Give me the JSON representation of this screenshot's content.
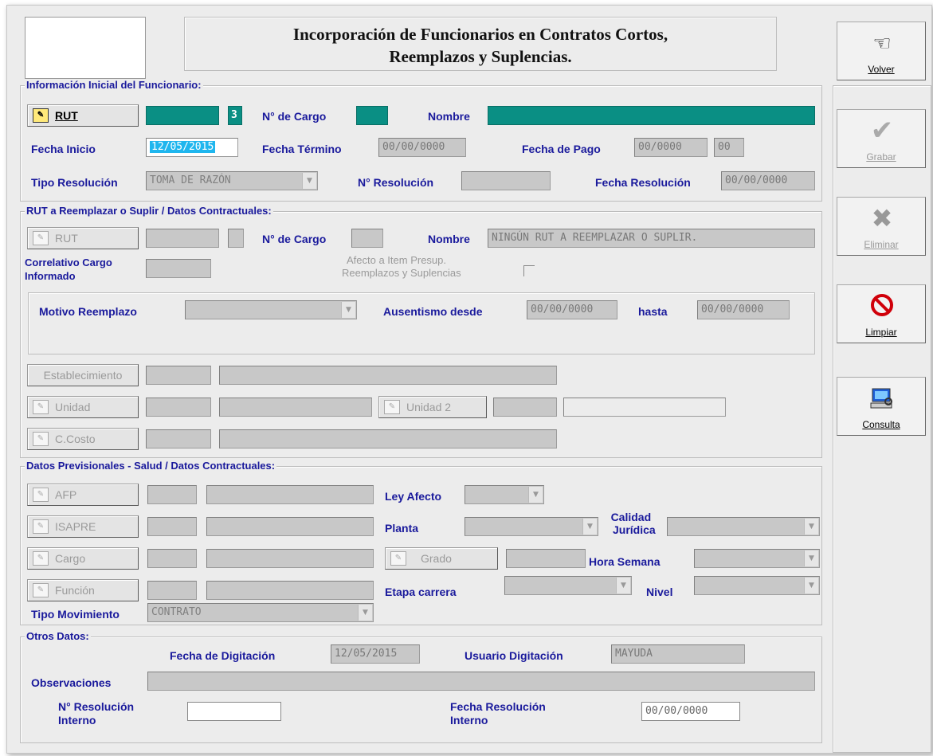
{
  "header": {
    "title_line1": "Incorporación de Funcionarios en Contratos Cortos,",
    "title_line2": "Reemplazos y Suplencias."
  },
  "sidebar": {
    "volver": "Volver",
    "grabar": "Grabar",
    "eliminar": "Eliminar",
    "limpiar": "Limpiar",
    "consulta": "Consulta"
  },
  "section1": {
    "legend": "Información Inicial del Funcionario:",
    "rut_btn": "RUT",
    "rut_value": "",
    "rut_dv": "3",
    "ncargo_label": "N° de Cargo",
    "ncargo_value": "",
    "nombre_label": "Nombre",
    "nombre_value": "",
    "fecha_inicio_label": "Fecha Inicio",
    "fecha_inicio_value": "12/05/2015",
    "fecha_termino_label": "Fecha Término",
    "fecha_termino_value": "00/00/0000",
    "fecha_pago_label": "Fecha de Pago",
    "fecha_pago_value1": "00/0000",
    "fecha_pago_value2": "00",
    "tipo_resolucion_label": "Tipo Resolución",
    "tipo_resolucion_value": "TOMA DE RAZÓN",
    "nresolucion_label": "N° Resolución",
    "nresolucion_value": "",
    "fecha_resolucion_label": "Fecha Resolución",
    "fecha_resolucion_value": "00/00/0000"
  },
  "section2": {
    "legend": "RUT a Reemplazar o Suplir / Datos Contractuales:",
    "rut_btn": "RUT",
    "ncargo_label": "N° de Cargo",
    "nombre_label": "Nombre",
    "nombre_value": "NINGÚN RUT A REEMPLAZAR O SUPLIR.",
    "correlativo_label_1": "Correlativo Cargo",
    "correlativo_label_2": "Informado",
    "afecto_label_1": "Afecto a Item Presup.",
    "afecto_label_2": "Reemplazos y Suplencias",
    "motivo_label": "Motivo Reemplazo",
    "motivo_value": "",
    "ausentismo_label": "Ausentismo desde",
    "ausentismo_desde": "00/00/0000",
    "hasta_label": "hasta",
    "ausentismo_hasta": "00/00/0000",
    "establecimiento_btn": "Establecimiento",
    "unidad_btn": "Unidad",
    "unidad2_btn": "Unidad 2",
    "ccosto_btn": "C.Costo"
  },
  "section3": {
    "legend": "Datos Previsionales - Salud / Datos Contractuales:",
    "afp_btn": "AFP",
    "isapre_btn": "ISAPRE",
    "cargo_btn": "Cargo",
    "funcion_btn": "Función",
    "ley_afecto_label": "Ley Afecto",
    "planta_label": "Planta",
    "calidad_label_1": "Calidad",
    "calidad_label_2": "Jurídica",
    "grado_btn": "Grado",
    "hora_semana_label": "Hora Semana",
    "etapa_label": "Etapa carrera",
    "nivel_label": "Nivel",
    "tipo_mov_label": "Tipo Movimiento",
    "tipo_mov_value": "CONTRATO"
  },
  "section4": {
    "legend": "Otros Datos:",
    "fecha_dig_label": "Fecha de Digitación",
    "fecha_dig_value": "12/05/2015",
    "usuario_label": "Usuario Digitación",
    "usuario_value": "MAYUDA",
    "obs_label": "Observaciones",
    "obs_value": "",
    "nres_int_label_1": "N° Resolución",
    "nres_int_label_2": "Interno",
    "nres_int_value": "",
    "fres_int_label_1": "Fecha Resolución",
    "fres_int_label_2": "Interno",
    "fres_int_value": "00/00/0000"
  }
}
